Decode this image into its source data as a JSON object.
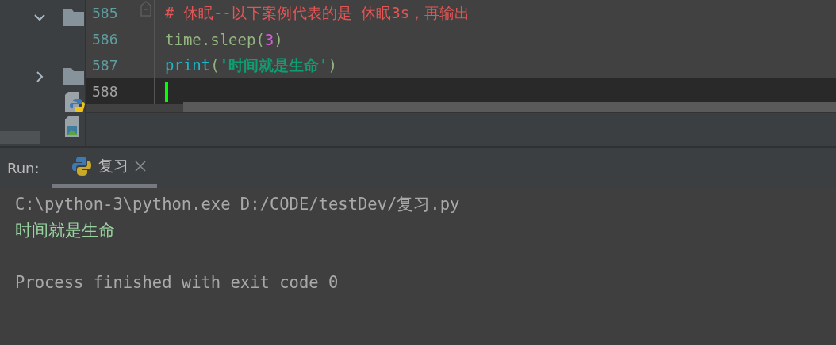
{
  "project_tree": {
    "items": [
      {
        "kind": "folder",
        "expanded": true
      },
      {
        "kind": "folder",
        "expanded": false
      },
      {
        "kind": "python-file"
      },
      {
        "kind": "image-file"
      }
    ]
  },
  "editor": {
    "lines": [
      {
        "number": "585",
        "current": false,
        "fold": true,
        "segments": [
          {
            "kind": "comment",
            "text": "# 休眠--以下案例代表的是 休眠3s，再输出"
          }
        ]
      },
      {
        "number": "586",
        "current": false,
        "fold": false,
        "segments": [
          {
            "kind": "plain",
            "text": "time.sleep("
          },
          {
            "kind": "number",
            "text": "3"
          },
          {
            "kind": "plain",
            "text": ")"
          }
        ]
      },
      {
        "number": "587",
        "current": false,
        "fold": false,
        "segments": [
          {
            "kind": "builtin",
            "text": "print"
          },
          {
            "kind": "plain",
            "text": "("
          },
          {
            "kind": "string",
            "text": "'时间就是生命'"
          },
          {
            "kind": "plain",
            "text": ")"
          }
        ]
      },
      {
        "number": "588",
        "current": true,
        "fold": false
      }
    ]
  },
  "run_panel": {
    "label": "Run:",
    "tabs": [
      {
        "label": "复习",
        "selected": true
      }
    ],
    "console": [
      {
        "kind": "command",
        "text": "C:\\python-3\\python.exe D:/CODE/testDev/复习.py"
      },
      {
        "kind": "output",
        "text": "时间就是生命"
      },
      {
        "kind": "exit",
        "text": "Process finished with exit code 0"
      }
    ]
  }
}
